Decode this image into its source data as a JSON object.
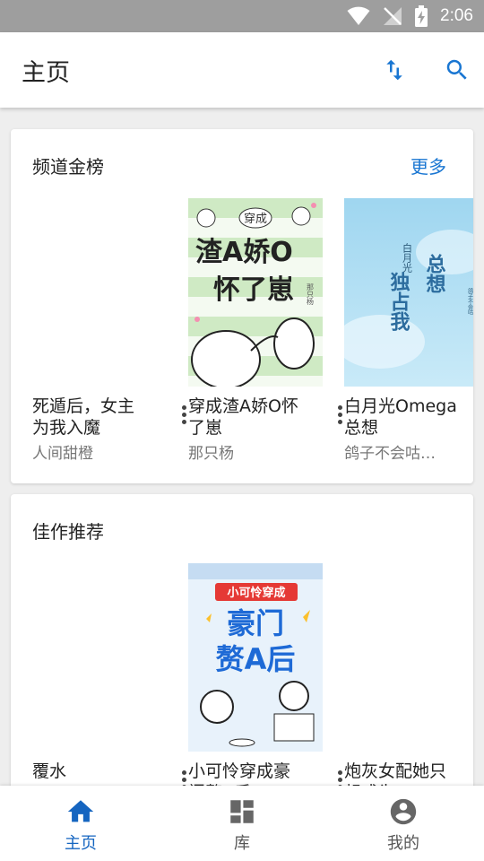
{
  "status_bar": {
    "time": "2:06"
  },
  "app_bar": {
    "title": "主页"
  },
  "sections": [
    {
      "title": "频道金榜",
      "more_label": "更多",
      "books": [
        {
          "title": "死遁后，女主为我入魔",
          "author": "人间甜橙"
        },
        {
          "title": "穿成渣A娇O怀了崽",
          "author": "那只杨",
          "cover_text": [
            "穿成",
            "渣A娇O",
            "怀了崽",
            "那只杨"
          ]
        },
        {
          "title": "白月光Omega总想",
          "author": "鸽子不会咕…",
          "cover_text": [
            "白月光",
            "总想",
            "独占我",
            "鸽子不会咕"
          ]
        }
      ]
    },
    {
      "title": "佳作推荐",
      "books": [
        {
          "title": "覆水",
          "author": ""
        },
        {
          "title": "小可怜穿成豪门赘A后",
          "author": "",
          "cover_text": [
            "小可怜穿成",
            "豪门",
            "赘A后"
          ]
        },
        {
          "title": "炮灰女配她只想成为",
          "author": ""
        }
      ]
    }
  ],
  "bottom_nav": [
    {
      "label": "主页",
      "icon": "home-icon",
      "active": true
    },
    {
      "label": "库",
      "icon": "library-icon",
      "active": false
    },
    {
      "label": "我的",
      "icon": "account-icon",
      "active": false
    }
  ],
  "colors": {
    "accent": "#1976d2",
    "status_bar": "#9e9e9e"
  }
}
